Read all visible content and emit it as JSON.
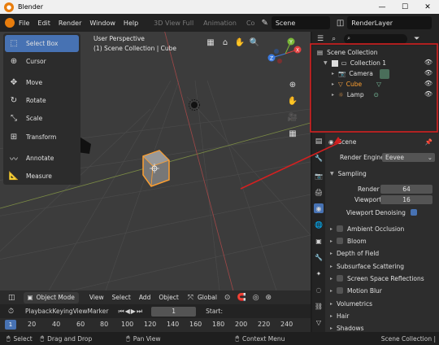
{
  "titlebar": {
    "title": "Blender",
    "minimize": "—",
    "maximize": "☐",
    "close": "✕"
  },
  "menu": [
    "File",
    "Edit",
    "Render",
    "Window",
    "Help"
  ],
  "workspaces": [
    "3D View Full",
    "Animation",
    "Co"
  ],
  "scene": {
    "name": "Scene"
  },
  "renderlayer": {
    "name": "RenderLayer"
  },
  "viewport": {
    "perspective": "User Perspective",
    "collection_label": "(1) Scene Collection | Cube"
  },
  "tools": [
    {
      "label": "Select Box",
      "icon": "select-box-icon"
    },
    {
      "label": "Cursor",
      "icon": "cursor-icon"
    },
    {
      "label": "Move",
      "icon": "move-icon"
    },
    {
      "label": "Rotate",
      "icon": "rotate-icon"
    },
    {
      "label": "Scale",
      "icon": "scale-icon"
    },
    {
      "label": "Transform",
      "icon": "transform-icon"
    },
    {
      "label": "Annotate",
      "icon": "annotate-icon"
    },
    {
      "label": "Measure",
      "icon": "measure-icon"
    }
  ],
  "gizmo": {
    "x": "X",
    "y": "Y",
    "z": "Z"
  },
  "viewport_header": {
    "mode": "Object Mode",
    "menus": [
      "View",
      "Select",
      "Add",
      "Object"
    ],
    "transform": "Global"
  },
  "outliner": {
    "root": "Scene Collection",
    "collection": "Collection 1",
    "items": [
      "Camera",
      "Cube",
      "Lamp"
    ]
  },
  "properties": {
    "title": "Scene",
    "render_engine_label": "Render Engine",
    "render_engine": "Eevee",
    "sampling": "Sampling",
    "render_label": "Render",
    "render_value": "64",
    "viewport_label": "Viewport",
    "viewport_value": "16",
    "viewport_denoising": "Viewport Denoising",
    "panels": [
      "Ambient Occlusion",
      "Bloom",
      "Depth of Field",
      "Subsurface Scattering",
      "Screen Space Reflections",
      "Motion Blur",
      "Volumetrics",
      "Hair",
      "Shadows"
    ]
  },
  "timeline": {
    "menus": [
      "Playback",
      "Keying",
      "View",
      "Marker"
    ],
    "frame": "1",
    "start_label": "Start:",
    "ticks": [
      "1",
      "20",
      "40",
      "60",
      "80",
      "100",
      "120",
      "140",
      "160",
      "180",
      "200",
      "220",
      "240"
    ]
  },
  "statusbar": {
    "select": "Select",
    "drag": "Drag and Drop",
    "pan": "Pan View",
    "context": "Context Menu",
    "right": "Scene Collection |"
  },
  "colors": {
    "accent": "#4772b3",
    "annotation_red": "#d42020",
    "selected_orange": "#ffa030"
  }
}
